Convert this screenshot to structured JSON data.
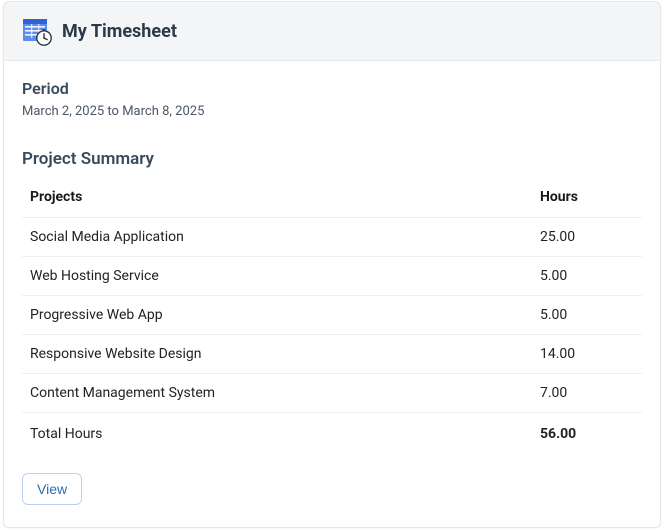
{
  "header": {
    "title": "My Timesheet"
  },
  "period": {
    "label": "Period",
    "value": "March 2, 2025 to March 8, 2025"
  },
  "summary": {
    "heading": "Project Summary",
    "columns": {
      "project": "Projects",
      "hours": "Hours"
    },
    "rows": [
      {
        "project": "Social Media Application",
        "hours": "25.00"
      },
      {
        "project": "Web Hosting Service",
        "hours": "5.00"
      },
      {
        "project": "Progressive Web App",
        "hours": "5.00"
      },
      {
        "project": "Responsive Website Design",
        "hours": "14.00"
      },
      {
        "project": "Content Management System",
        "hours": "7.00"
      }
    ],
    "total": {
      "label": "Total Hours",
      "hours": "56.00"
    }
  },
  "actions": {
    "view": "View"
  }
}
